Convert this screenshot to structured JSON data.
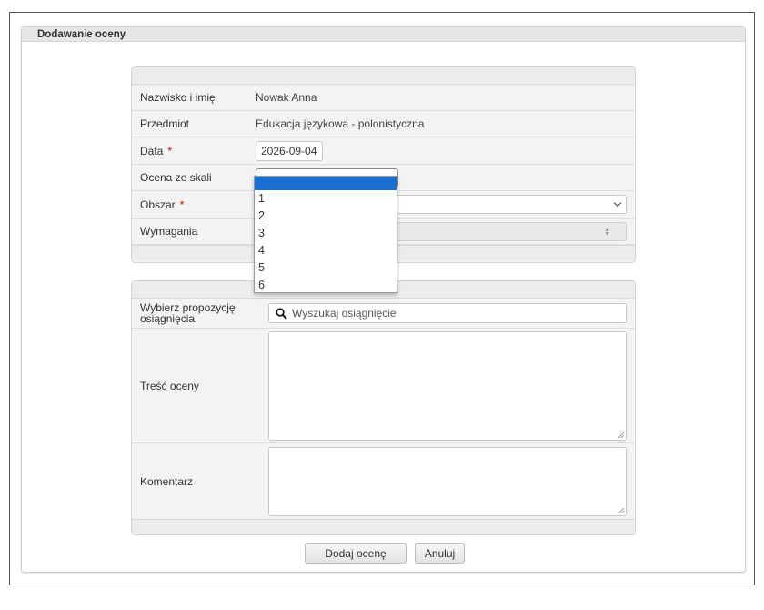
{
  "panel": {
    "title": "Dodawanie oceny"
  },
  "form": {
    "student": {
      "label": "Nazwisko i imię",
      "value": "Nowak Anna"
    },
    "subject": {
      "label": "Przedmiot",
      "value": "Edukacja językowa - polonistyczna"
    },
    "date": {
      "label": "Data",
      "required_mark": "*",
      "value": "2026-09-04"
    },
    "grade": {
      "label": "Ocena ze skali",
      "value": "",
      "options": [
        "",
        "1",
        "2",
        "3",
        "4",
        "5",
        "6"
      ]
    },
    "area": {
      "label": "Obszar",
      "required_mark": "*",
      "value": ""
    },
    "requirements": {
      "label": "Wymagania",
      "value": ""
    }
  },
  "details": {
    "achievement": {
      "label": "Wybierz propozycję osiągnięcia",
      "placeholder": "Wyszukaj osiągnięcie"
    },
    "content": {
      "label": "Treść oceny",
      "value": ""
    },
    "comment": {
      "label": "Komentarz",
      "value": ""
    }
  },
  "buttons": {
    "add": "Dodaj ocenę",
    "cancel": "Anuluj"
  },
  "colors": {
    "selected_option": "#1a6fd2",
    "required": "#d10000"
  }
}
